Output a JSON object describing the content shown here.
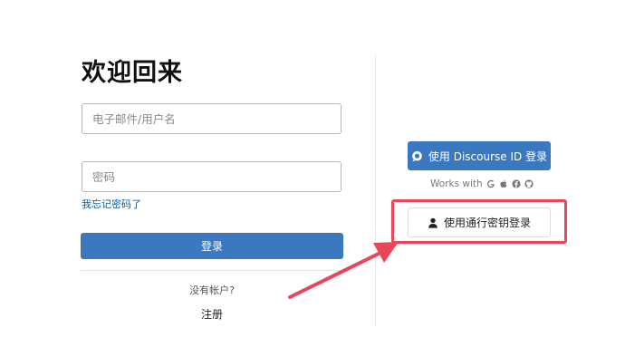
{
  "login": {
    "title": "欢迎回来",
    "email_placeholder": "电子邮件/用户名",
    "password_placeholder": "密码",
    "forgot_password": "我忘记密码了",
    "login_button": "登录",
    "no_account": "没有帐户?",
    "signup": "注册"
  },
  "alt_login": {
    "discourse_id_button": "使用 Discourse ID 登录",
    "discourse_icon": "speech-bubble-icon",
    "works_with": "Works with",
    "works_with_icons": [
      "google-icon",
      "apple-icon",
      "facebook-icon",
      "github-icon"
    ],
    "passkey_button": "使用通行密钥登录",
    "passkey_icon": "user-icon"
  },
  "colors": {
    "primary": "#3a78c0",
    "link": "#0a5ca8",
    "annotation": "#e8465b"
  }
}
